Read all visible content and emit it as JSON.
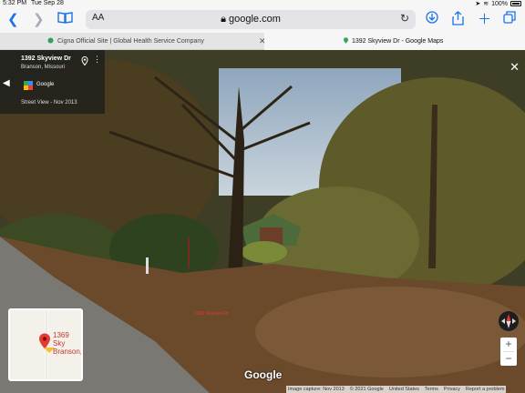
{
  "status": {
    "time": "5:32 PM",
    "date": "Tue Sep 28",
    "battery": "100%"
  },
  "toolbar": {
    "text_size": "AA",
    "url": "google.com"
  },
  "tabs": [
    {
      "title": "Cigna Official Site | Global Health Service Company",
      "active": false
    },
    {
      "title": "1392 Skyview Dr - Google Maps",
      "active": true
    }
  ],
  "card": {
    "address": "1392 Skyview Dr",
    "city": "Branson, Missouri",
    "provider": "Google",
    "sv_date": "Street View - Nov 2013"
  },
  "overlay_label": "1392 Skyview Dr",
  "minimap": {
    "line1": "1369 Sky",
    "line2": "Branson,"
  },
  "brand": "Google",
  "footer": {
    "capture": "Image capture: Nov 2013",
    "copyright": "© 2021 Google",
    "country": "United States",
    "terms": "Terms",
    "privacy": "Privacy",
    "report": "Report a problem"
  },
  "colors": {
    "accent": "#1a73e8",
    "pin": "#e53935"
  }
}
